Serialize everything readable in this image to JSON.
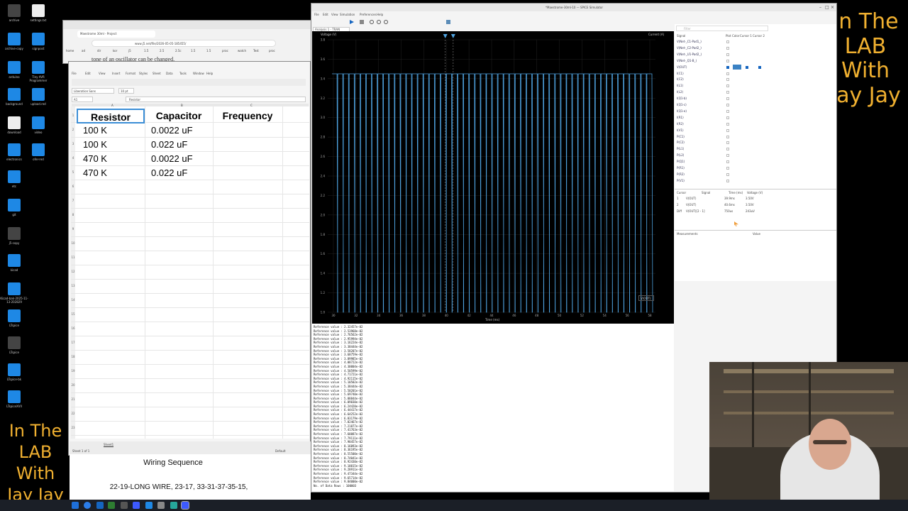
{
  "desktop": {
    "icons": [
      {
        "label": "archive",
        "kind": "dark"
      },
      {
        "label": "settings.txt",
        "kind": "file"
      },
      {
        "label": "archive-copy",
        "kind": "blue"
      },
      {
        "label": "signpost",
        "kind": "blue"
      },
      {
        "label": "arduino",
        "kind": "blue"
      },
      {
        "label": "Tiny AVR Programmer",
        "kind": "blue"
      },
      {
        "label": "background",
        "kind": "blue"
      },
      {
        "label": "upload.red",
        "kind": "blue"
      },
      {
        "label": "download",
        "kind": "file"
      },
      {
        "label": "video",
        "kind": "blue"
      },
      {
        "label": "electronics",
        "kind": "blue"
      },
      {
        "label": "ofer-red",
        "kind": "blue"
      },
      {
        "label": "etc",
        "kind": "blue"
      },
      {
        "label": "git",
        "kind": "blue"
      },
      {
        "label": "j5-copy",
        "kind": "dark"
      },
      {
        "label": "kicad",
        "kind": "blue"
      },
      {
        "label": "Kicad-bak-2025-11-13-202829",
        "kind": "blue"
      },
      {
        "label": "LTspice",
        "kind": "blue"
      },
      {
        "label": "LTspice",
        "kind": "dark"
      },
      {
        "label": "LTspice-bk",
        "kind": "blue"
      },
      {
        "label": "LTspiceXVII",
        "kind": "blue"
      }
    ]
  },
  "brand": {
    "top_lines": [
      "In The",
      "LAB",
      "With",
      "Jay Jay"
    ],
    "bottom_lines": [
      "In The",
      "LAB",
      "With",
      "Jay Jay"
    ]
  },
  "browser": {
    "tab_title": "Maestrome 30ml - Project",
    "url": "www.j5.net/file/2026-05-05-185455/",
    "page_text": "tone of an oscillator can be changed.",
    "bookmarks": [
      "home",
      "ad",
      "dir",
      "kor",
      "j5",
      "1.5",
      "2.5",
      "2.5c",
      "1.5",
      "1.5",
      "prac",
      "watch",
      "Test",
      "proc"
    ]
  },
  "calc": {
    "menu": [
      "File",
      "Edit",
      "View",
      "Insert",
      "Format",
      "Styles",
      "Sheet",
      "Data",
      "Tools",
      "Window",
      "Help"
    ],
    "font_name": "Liberation Sans",
    "font_size": "10 pt",
    "cell_ref": "A1",
    "formula_value": "Resistor",
    "columns": [
      "A",
      "B",
      "C"
    ],
    "headers": [
      "Resistor",
      "Capacitor",
      "Frequency"
    ],
    "rows": [
      [
        "100 K",
        "0.0022 uF",
        ""
      ],
      [
        "100 K",
        "0.022 uF",
        ""
      ],
      [
        "470 K",
        "0.0022 uF",
        ""
      ],
      [
        "470 K",
        "0.022 uF",
        ""
      ]
    ],
    "row_numbers": [
      "1",
      "2",
      "3",
      "4",
      "5",
      "6",
      "7",
      "8",
      "9",
      "10",
      "11",
      "12",
      "13",
      "14",
      "15",
      "16",
      "17",
      "18",
      "19",
      "20",
      "21",
      "22",
      "23"
    ],
    "sheet_tab": "Sheet1",
    "status_left": "Sheet 1 of 1",
    "status_mid": "Default"
  },
  "notes": {
    "title": "Wiring Sequence",
    "text": "22-19-LONG WIRE, 23-17, 33-31-37-35-15,"
  },
  "spice": {
    "title": "*Maestrome-30ml-10 — SPICE Simulator",
    "menu": [
      "File",
      "Edit",
      "View",
      "Simulation",
      "Preferences",
      "Help"
    ],
    "tab": "Analysis 1 - TRAN",
    "y_axis_label": "Voltage (V)",
    "y2_axis_label": "Current (A)",
    "x_axis_label": "Time (ms)",
    "y_ticks": [
      "3.8",
      "3.6",
      "3.4",
      "3.2",
      "3.0",
      "2.8",
      "2.6",
      "2.4",
      "2.2",
      "2.0",
      "1.8",
      "1.6",
      "1.4",
      "1.2",
      "1.0"
    ],
    "x_ticks": [
      "30",
      "32",
      "34",
      "36",
      "38",
      "40",
      "42",
      "44",
      "46",
      "48",
      "50",
      "52",
      "54",
      "56",
      "58"
    ],
    "legend": "V(OUT)",
    "filter_placeholder": "Filter",
    "signal_header": [
      "Signal",
      "Plot",
      "Color",
      "Cursor 1",
      "Cursor 2"
    ],
    "signals": [
      "V(Net-_C1-Pad1_)",
      "V(Net-_C2-Pad2_)",
      "V(Net-_U1-Pad2_)",
      "V(Net-_Q1-B_)",
      "V(OUT)",
      "I(C1)",
      "I(C2)",
      "I(L1)",
      "I(L2)",
      "I(Q1-b)",
      "I(Q1-c)",
      "I(Q1-e)",
      "I(R1)",
      "I(R2)",
      "I(V1)",
      "P(C1)",
      "P(C2)",
      "P(L1)",
      "P(L2)",
      "P(Q1)",
      "P(R1)",
      "P(R2)",
      "P(V1)"
    ],
    "cursor_header": [
      "Cursor",
      "Signal",
      "Time (ms)",
      "Voltage (V)"
    ],
    "cursors": [
      [
        "1",
        "V(OUT)",
        "39.9ms",
        "3.50V"
      ],
      [
        "2",
        "V(OUT)",
        "40.6ms",
        "3.50V"
      ],
      [
        "Diff",
        "V(OUT)[2 - 1]",
        "750us",
        "243uV"
      ]
    ],
    "measurements_header": [
      "Measurements",
      "Value"
    ],
    "console_prefix": "Reference value :",
    "console_values": [
      "2.32457e-02",
      "2.53968e-02",
      "2.76562e-02",
      "2.95994e-02",
      "3.16224e-02",
      "3.38444e-02",
      "3.58207e-02",
      "3.68759e-02",
      "3.89985e-02",
      "4.08722e-02",
      "4.30004e-02",
      "4.50599e-02",
      "4.71721e-02",
      "4.92115e-02",
      "5.10502e-02",
      "5.38444e-02",
      "5.50201e-02",
      "5.69740e-02",
      "5.88844e-02",
      "6.09030e-02",
      "6.24420e-02",
      "6.44417e-02",
      "6.64252e-02",
      "6.83179e-02",
      "7.02467e-02",
      "7.21877e-02",
      "7.41763e-02",
      "7.60087e-02",
      "7.79111e-02",
      "7.98457e-02",
      "8.16093e-02",
      "8.36195e-02",
      "8.55500e-02",
      "8.74041e-02",
      "8.92430e-02",
      "9.10015e-02",
      "9.28911e-02",
      "9.47344e-02",
      "9.65714e-02",
      "9.84000e-02"
    ],
    "console_footer": "No. of Data Rows : 100003"
  }
}
